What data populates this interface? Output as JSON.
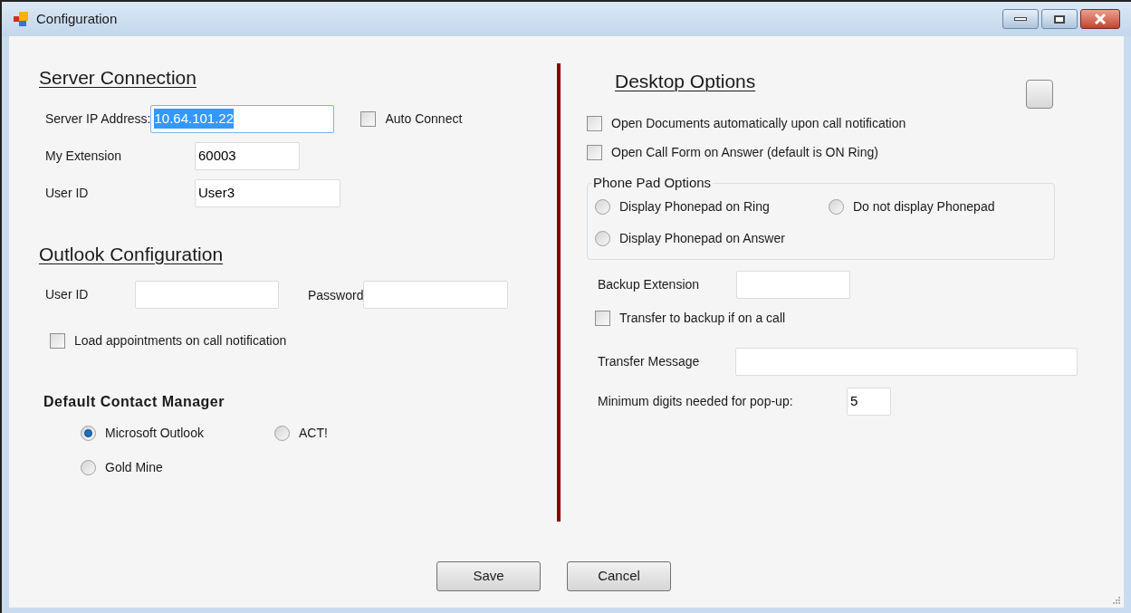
{
  "window": {
    "title": "Configuration"
  },
  "server_connection": {
    "heading": "Server Connection",
    "fields": [
      {
        "label": "Server IP Address:",
        "value": "10.64.101.22",
        "focused": true
      },
      {
        "label": "My Extension",
        "value": "60003",
        "focused": false
      },
      {
        "label": "User ID",
        "value": "User3",
        "focused": false
      }
    ],
    "auto_connect": {
      "label": "Auto Connect",
      "checked": false
    }
  },
  "outlook_configuration": {
    "heading": "Outlook Configuration",
    "user_id": {
      "label": "User ID"
    },
    "password": {
      "label": "Password"
    },
    "load_appointments": {
      "label": "Load appointments on call notification",
      "checked": false
    }
  },
  "default_contact_manager": {
    "heading": "Default Contact Manager",
    "options": [
      {
        "label": "Microsoft Outlook",
        "selected": true
      },
      {
        "label": "ACT!",
        "selected": false
      },
      {
        "label": "Gold Mine",
        "selected": false
      }
    ]
  },
  "desktop_options": {
    "heading": "Desktop Options",
    "checkboxes": [
      {
        "label": "Open Documents automatically upon call notification",
        "checked": false
      },
      {
        "label": "Open Call Form on Answer (default is ON Ring)",
        "checked": false
      }
    ],
    "phone_pad": {
      "title": "Phone Pad Options",
      "options": [
        {
          "label": "Display Phonepad on Ring",
          "selected": false
        },
        {
          "label": "Do not display Phonepad",
          "selected": false
        },
        {
          "label": "Display Phonepad on Answer",
          "selected": false
        }
      ]
    },
    "backup_extension": {
      "label": "Backup Extension"
    },
    "transfer_to_backup": {
      "label": "Transfer to backup if on a call",
      "checked": false
    },
    "transfer_message": {
      "label": "Transfer Message"
    },
    "minimum_digits": {
      "label": "Minimum digits needed for pop-up:",
      "value": "5"
    }
  },
  "buttons": [
    "Save",
    "Cancel"
  ]
}
